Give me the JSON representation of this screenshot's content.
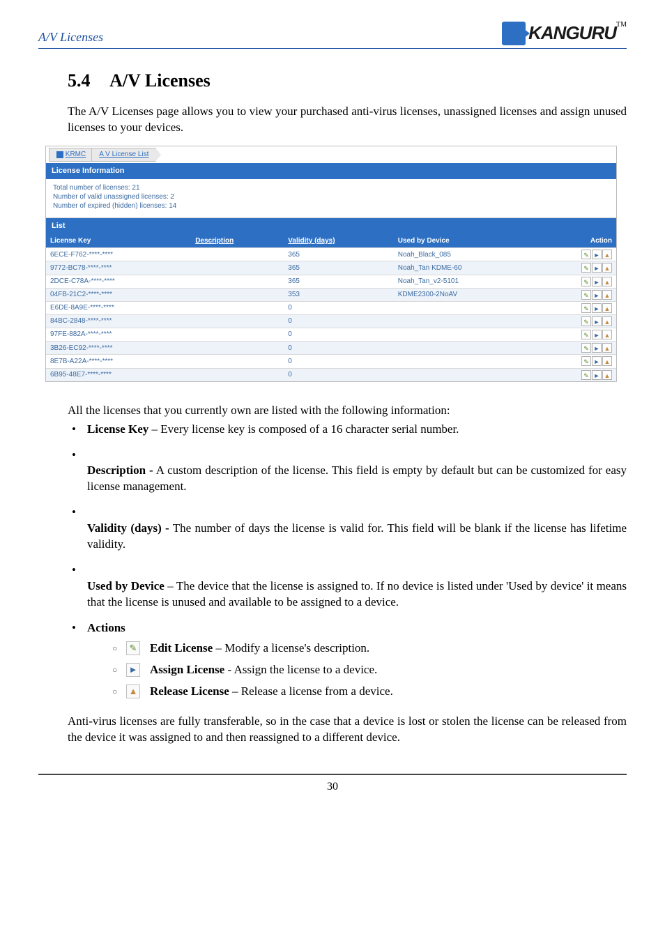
{
  "page": {
    "header_left": "A/V Licenses",
    "logo_text": "KANGURU",
    "tm": "TM",
    "section_number": "5.4",
    "section_title": "A/V Licenses",
    "intro": "The A/V Licenses page allows you to view your purchased anti-virus licenses, unassigned licenses and assign unused licenses to your devices.",
    "lead_line": "All the licenses that you currently own are listed with the following information:",
    "actions_label": "Actions",
    "closing": "Anti-virus licenses are fully transferable, so in the case that a device is lost or stolen the license can be released from the device it was assigned to and then reassigned to a different device.",
    "footer_page": "30"
  },
  "shot": {
    "crumb_home": "KRMC",
    "crumb_page": "A V License List",
    "panel_licinfo": "License Information",
    "total_line": "Total number of licenses: 21",
    "unassigned_line": "Number of valid unassigned licenses: 2",
    "expired_line": "Number of expired (hidden) licenses: 14",
    "panel_list": "List",
    "headers": {
      "key": "License Key",
      "desc": "Description",
      "validity": "Validity (days)",
      "used": "Used by Device",
      "action": "Action"
    },
    "rows": [
      {
        "key": "6ECE-F762-****-****",
        "desc": "",
        "validity": "365",
        "used": "Noah_Black_085"
      },
      {
        "key": "9772-BC78-****-****",
        "desc": "",
        "validity": "365",
        "used": "Noah_Tan KDME-60"
      },
      {
        "key": "2DCE-C78A-****-****",
        "desc": "",
        "validity": "365",
        "used": "Noah_Tan_v2-5101"
      },
      {
        "key": "04FB-21C2-****-****",
        "desc": "",
        "validity": "353",
        "used": "KDME2300-2NoAV"
      },
      {
        "key": "E6DE-8A9E-****-****",
        "desc": "",
        "validity": "0",
        "used": ""
      },
      {
        "key": "84BC-2848-****-****",
        "desc": "",
        "validity": "0",
        "used": ""
      },
      {
        "key": "97FE-882A-****-****",
        "desc": "",
        "validity": "0",
        "used": ""
      },
      {
        "key": "3B26-EC92-****-****",
        "desc": "",
        "validity": "0",
        "used": ""
      },
      {
        "key": "8E7B-A22A-****-****",
        "desc": "",
        "validity": "0",
        "used": ""
      },
      {
        "key": "6B95-48E7-****-****",
        "desc": "",
        "validity": "0",
        "used": ""
      }
    ]
  },
  "bullets": {
    "license_key_t": "License Key",
    "license_key_b": " – Every license key is composed of a 16 character serial number.",
    "description_t": "Description -",
    "description_b": " A custom description of the license. This field is empty by default but can be customized for easy license management.",
    "validity_t": "Validity (days) -",
    "validity_b": " The number of days the license is valid for. This field will be blank if the license has lifetime validity.",
    "used_t": "Used by Device",
    "used_b": " – The device that the license is assigned to. If no device is listed under 'Used by device' it means that the license is unused and available to be assigned to a device.",
    "edit_t": "Edit License",
    "edit_b": " – Modify a license's description.",
    "assign_t": "Assign License",
    "assign_b": " - Assign the license to a device.",
    "release_t": "Release License",
    "release_b": " – Release a license from a device."
  }
}
